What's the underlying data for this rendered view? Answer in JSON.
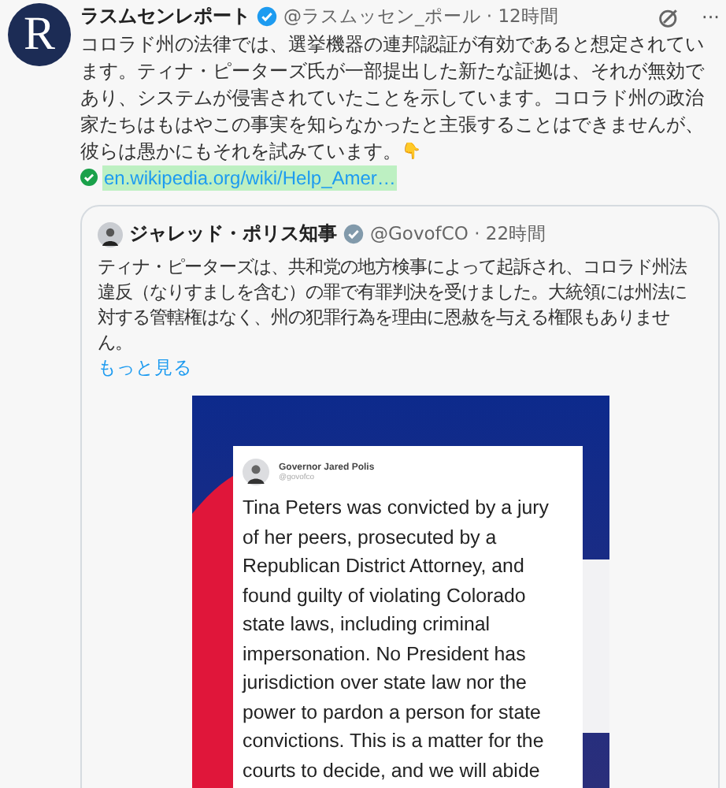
{
  "post": {
    "avatar_letter": "R",
    "author": "ラスムセンレポート",
    "verified": true,
    "handle": "@ラスムッセン_ポール",
    "separator": "·",
    "time": "12時間",
    "text": "コロラド州の法律では、選挙機器の連邦認証が有効であると想定されています。ティナ・ピーターズ氏が一部提出した新たな証拠は、それが無効であり、システムが侵害されていたことを示しています。コロラド州の政治家たちはもはやこの事実を知らなかったと主張することはできませんが、彼らは愚かにもそれを試みています。",
    "emoji": "👇",
    "link": "en.wikipedia.org/wiki/Help_Amer…",
    "more": "···"
  },
  "quote": {
    "author": "ジャレッド・ポリス知事",
    "verified": true,
    "handle": "@GovofCO",
    "separator": "·",
    "time": "22時間",
    "text": "ティナ・ピーターズは、共和党の地方検事によって起訴され、コロラド州法違反（なりすましを含む）の罪で有罪判決を受けました。大統領には州法に対する管轄権はなく、州の犯罪行為を理由に恩赦を与える権限もありません。",
    "show_more": "もっと見る",
    "image": {
      "name": "Governor Jared Polis",
      "handle": "@govofco",
      "lines": [
        "Tina Peters was convicted by a jury",
        "of her peers, prosecuted by a",
        "Republican District Attorney, and",
        "found guilty of violating Colorado",
        "state laws, including criminal",
        "impersonation. No President has",
        "jurisdiction over state law nor the",
        "power to pardon a person for state",
        "convictions. This is a matter for the",
        "courts to decide, and we will abide"
      ]
    }
  }
}
